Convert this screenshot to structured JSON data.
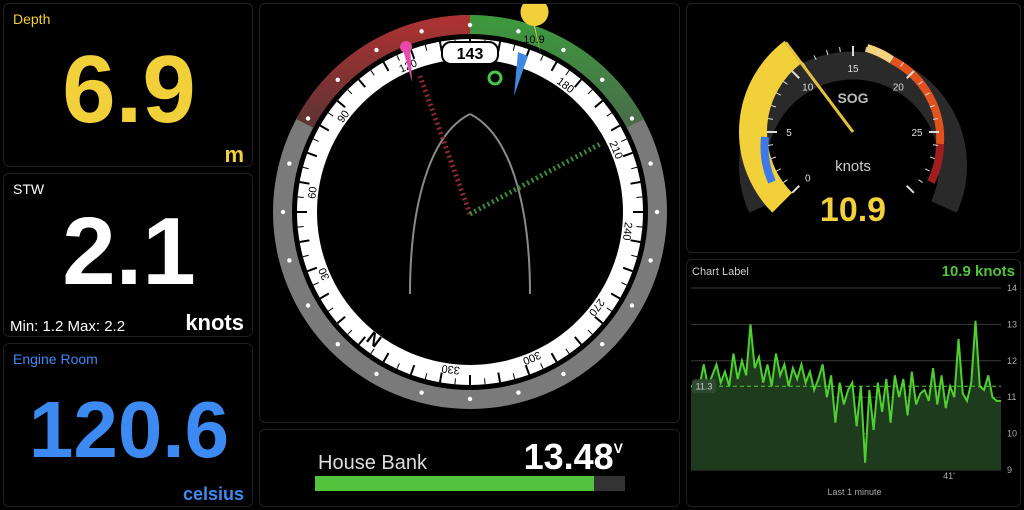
{
  "depth": {
    "title": "Depth",
    "value": "6.9",
    "unit": "m"
  },
  "stw": {
    "title": "STW",
    "value": "2.1",
    "unit": "knots",
    "minmax": "Min: 1.2 Max: 2.2"
  },
  "engine": {
    "title": "Engine Room",
    "value": "120.6",
    "unit": "celsius"
  },
  "compass": {
    "heading": "143",
    "marker_label": "10.9",
    "dial_labels": [
      "30",
      "60",
      "90",
      "120",
      "150",
      "180",
      "210",
      "240",
      "270",
      "300",
      "330",
      "N"
    ]
  },
  "battery": {
    "label": "House Bank",
    "value": "13.48",
    "unit": "V",
    "fill_fraction": 0.9
  },
  "sog": {
    "label": "SOG",
    "unit": "knots",
    "value": "10.9",
    "ticks": [
      "0",
      "5",
      "10",
      "15",
      "20",
      "25"
    ],
    "max": 30
  },
  "chart_panel": {
    "label": "Chart Label",
    "current": "10.9 knots",
    "xlabel": "Last 1 minute",
    "avg_label": "11.3",
    "time_tick": "41'"
  },
  "chart_data": {
    "type": "line",
    "xlabel": "Last 1 minute",
    "ylim": [
      9,
      14
    ],
    "yticks": [
      "9",
      "10",
      "11",
      "12",
      "13",
      "14"
    ],
    "average": 11.3,
    "series": [
      {
        "values": [
          11.3,
          11.3,
          11.3,
          11.9,
          11.3,
          11.6,
          11.9,
          11.4,
          11.7,
          11.3,
          12.2,
          11.5,
          12.0,
          11.6,
          13.0,
          11.8,
          12.1,
          11.4,
          11.9,
          11.3,
          12.2,
          11.6,
          11.9,
          11.3,
          11.8,
          11.5,
          11.9,
          11.4,
          11.7,
          11.2,
          11.5,
          11.9,
          11.0,
          11.6,
          10.3,
          11.4,
          10.8,
          11.2,
          11.4,
          10.2,
          11.3,
          9.2,
          11.2,
          10.1,
          11.4,
          10.6,
          11.5,
          10.3,
          11.6,
          11.0,
          11.5,
          10.5,
          11.7,
          10.8,
          11.1,
          11.2,
          10.9,
          11.8,
          10.8,
          11.6,
          10.7,
          11.3,
          11.0,
          12.6,
          11.1,
          10.9,
          11.4,
          13.1,
          11.3,
          11.2,
          11.6,
          11.0,
          10.9,
          10.9
        ]
      }
    ]
  }
}
